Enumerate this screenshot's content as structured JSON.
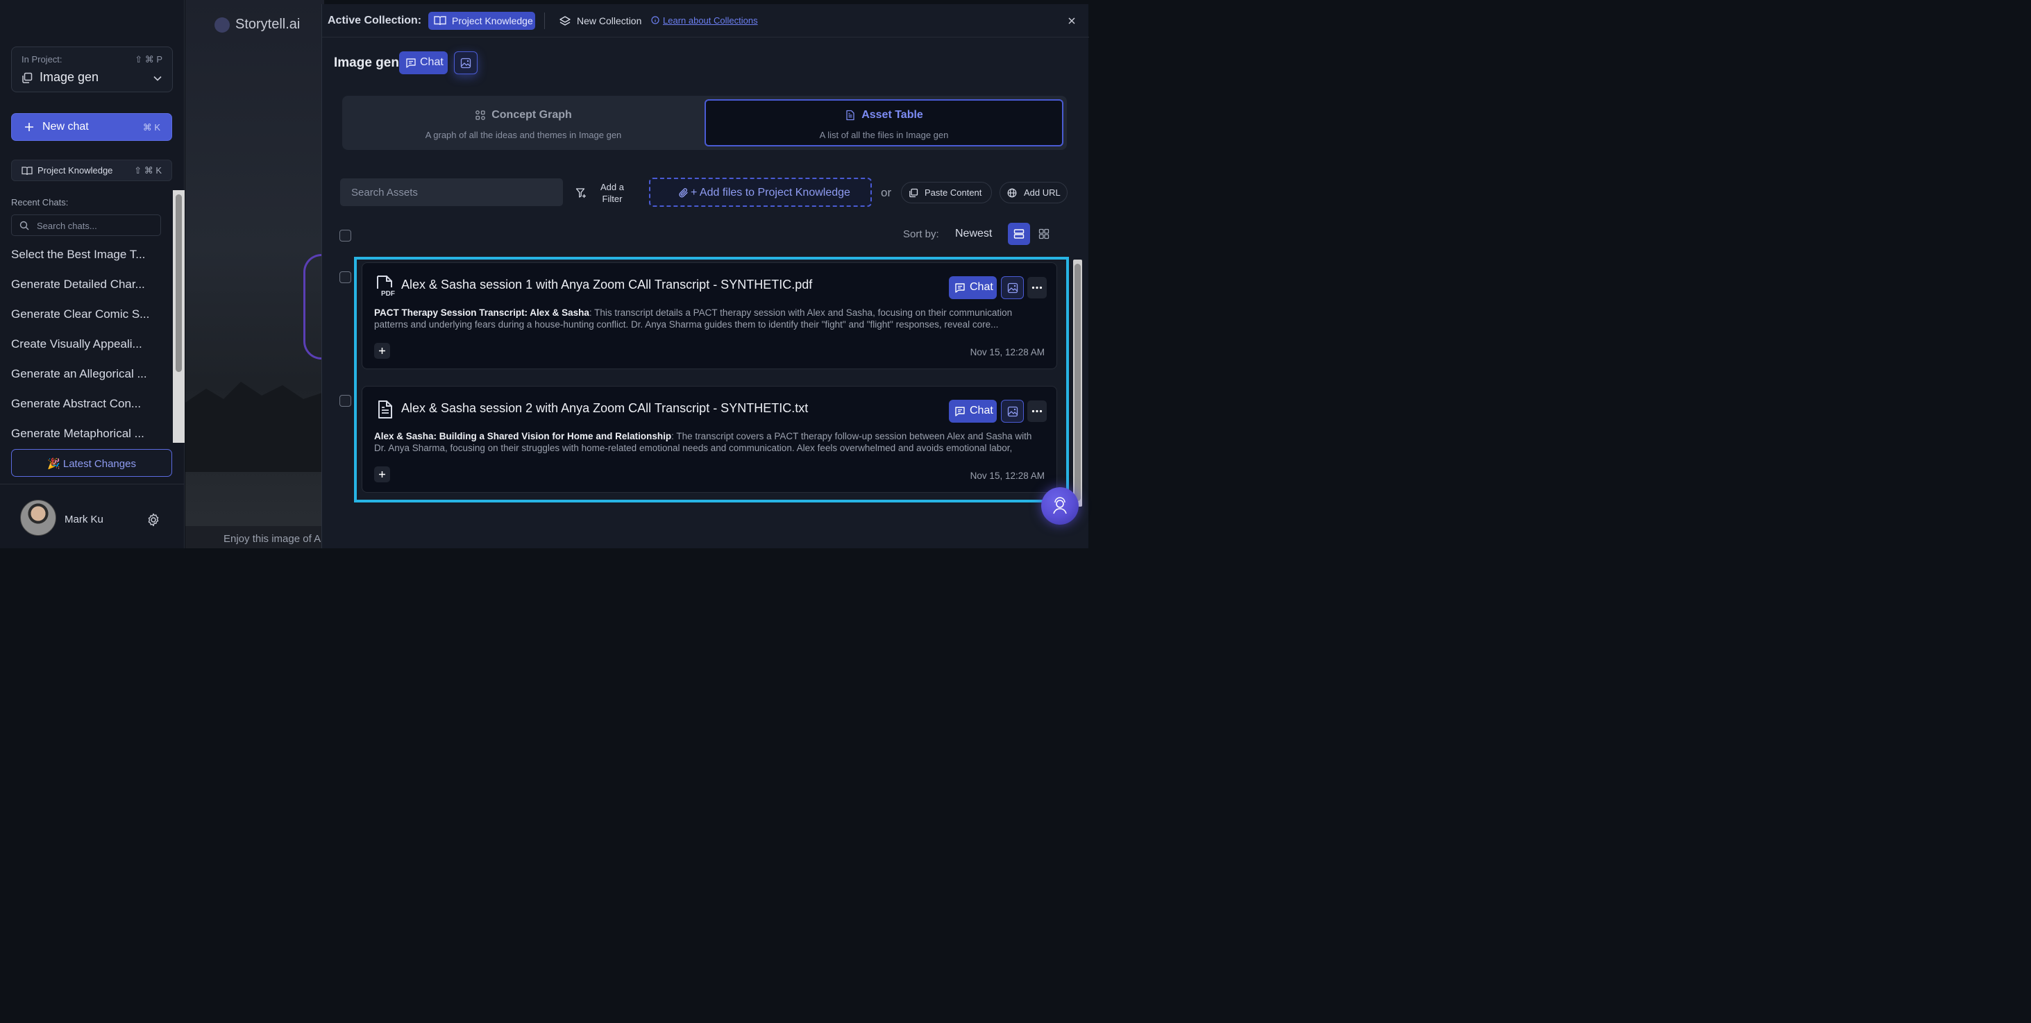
{
  "sidebar": {
    "project_label": "In Project:",
    "project_shortcut": "⇧ ⌘ P",
    "project_name": "Image gen",
    "new_chat_label": "New chat",
    "new_chat_shortcut": "⌘ K",
    "project_knowledge_label": "Project Knowledge",
    "project_knowledge_shortcut": "⇧ ⌘ K",
    "recent_title": "Recent Chats:",
    "search_placeholder": "Search chats...",
    "recent_chats": [
      "Select the Best Image T...",
      "Generate Detailed Char...",
      "Generate Clear Comic S...",
      "Create Visually Appeali...",
      "Generate an Allegorical ...",
      "Generate Abstract Con...",
      "Generate Metaphorical ..."
    ],
    "latest_changes_label": "🎉 Latest Changes",
    "user_name": "Mark Ku"
  },
  "background": {
    "logo_text": "Storytell.ai",
    "enjoy_text": "Enjoy this image of A"
  },
  "modal": {
    "active_collection_label": "Active Collection:",
    "active_collection_name": "Project Knowledge",
    "new_collection_label": "New Collection",
    "learn_label": "Learn about Collections",
    "collection_title": "Image gen",
    "chat_label": "Chat",
    "tabs": [
      {
        "title": "Concept Graph",
        "subtitle": "A graph of all the ideas and themes in Image gen"
      },
      {
        "title": "Asset Table",
        "subtitle": "A list of all the files in Image gen"
      }
    ],
    "active_tab": "Asset Table",
    "search_placeholder": "Search Assets",
    "add_filter_label": "Add a Filter",
    "add_files_label": "+ Add files to Project Knowledge",
    "or_text": "or",
    "paste_label": "Paste Content",
    "add_url_label": "Add URL",
    "sort_label": "Sort by:",
    "sort_value": "Newest",
    "view_mode": "list"
  },
  "assets": [
    {
      "file_type": "pdf",
      "name": "Alex & Sasha session 1 with Anya Zoom CAll Transcript - SYNTHETIC.pdf",
      "summary_title": "PACT Therapy Session Transcript: Alex & Sasha",
      "summary": ": This transcript details a PACT therapy session with Alex and Sasha, focusing on their communication patterns and underlying fears during a house-hunting conflict. Dr. Anya Sharma guides them to identify their \"fight\" and \"flight\" responses, reveal core...",
      "date": "Nov 15, 12:28 AM",
      "chat_label": "Chat"
    },
    {
      "file_type": "txt",
      "name": "Alex & Sasha session 2 with Anya Zoom CAll Transcript - SYNTHETIC.txt",
      "summary_title": "Alex & Sasha: Building a Shared Vision for Home and Relationship",
      "summary": ": The transcript covers a PACT therapy follow-up session between Alex and Sasha with Dr. Anya Sharma, focusing on their struggles with home-related emotional needs and communication. Alex feels overwhelmed and avoids emotional labor, fearing...",
      "date": "Nov 15, 12:28 AM",
      "chat_label": "Chat"
    }
  ],
  "colors": {
    "accent": "#4a5bd4",
    "highlight": "#27b4e4",
    "background": "#161b26"
  }
}
